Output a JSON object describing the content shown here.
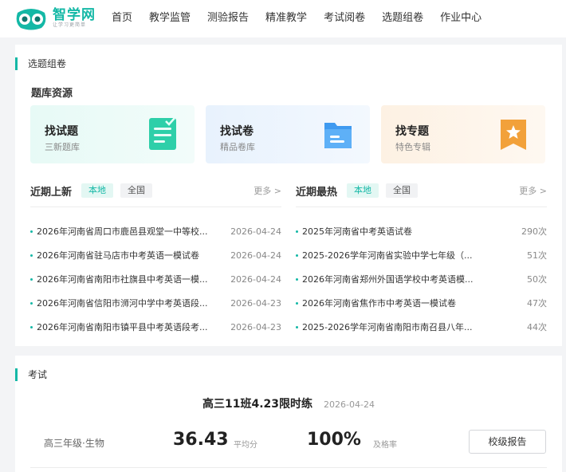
{
  "header": {
    "logo_name": "智学网",
    "logo_slogan": "让学习更简单",
    "nav": [
      "首页",
      "教学监管",
      "测验报告",
      "精准教学",
      "考试阅卷",
      "选题组卷",
      "作业中心"
    ]
  },
  "paper_section": {
    "title": "选题组卷",
    "bank_title": "题库资源",
    "resources": [
      {
        "name": "找试题",
        "desc": "三新题库",
        "icon": "document-checklist-icon",
        "color": "#2ecfa9"
      },
      {
        "name": "找试卷",
        "desc": "精品卷库",
        "icon": "folder-icon",
        "color": "#3f9af0"
      },
      {
        "name": "找专题",
        "desc": "特色专辑",
        "icon": "star-bookmark-icon",
        "color": "#f2a13a"
      }
    ],
    "recent": {
      "title": "近期上新",
      "tags": [
        "本地",
        "全国"
      ],
      "more": "更多 >",
      "items": [
        {
          "text": "2026年河南省周口市鹿邑县观堂一中等校...",
          "date": "2026-04-24"
        },
        {
          "text": "2026年河南省驻马店市中考英语一模试卷",
          "date": "2026-04-24"
        },
        {
          "text": "2026年河南省南阳市社旗县中考英语一模...",
          "date": "2026-04-24"
        },
        {
          "text": "2026年河南省信阳市浉河中学中考英语段...",
          "date": "2026-04-23"
        },
        {
          "text": "2026年河南省南阳市镇平县中考英语段考...",
          "date": "2026-04-23"
        }
      ]
    },
    "hot": {
      "title": "近期最热",
      "tags": [
        "本地",
        "全国"
      ],
      "more": "更多 >",
      "items": [
        {
          "text": "2025年河南省中考英语试卷",
          "count": "290次"
        },
        {
          "text": "2025-2026学年河南省实验中学七年级（...",
          "count": "51次"
        },
        {
          "text": "2026年河南省郑州外国语学校中考英语模...",
          "count": "50次"
        },
        {
          "text": "2026年河南省焦作市中考英语一模试卷",
          "count": "47次"
        },
        {
          "text": "2025-2026学年河南省南阳市南召县八年...",
          "count": "44次"
        }
      ]
    }
  },
  "exam_section": {
    "title": "考试",
    "exam_name": "高三11班4.23限时练",
    "exam_date": "2026-04-24",
    "class_subject": "高三年级·生物",
    "avg_score": "36.43",
    "avg_label": "平均分",
    "pass_rate": "100%",
    "pass_label": "及格率",
    "report_button": "校级报告"
  },
  "colors": {
    "accent": "#14b8a6",
    "page_bg": "#f3f4f6"
  }
}
